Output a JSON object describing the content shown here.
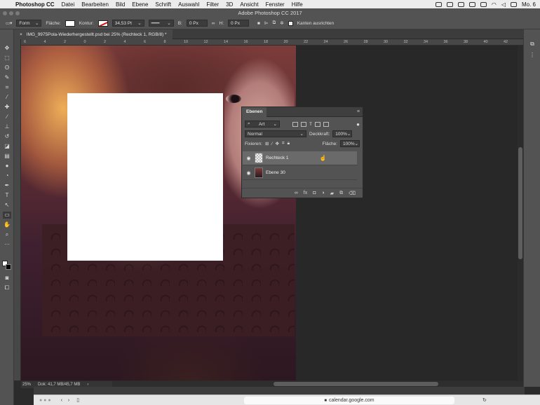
{
  "menubar": {
    "app_name": "Photoshop CC",
    "items": [
      "Datei",
      "Bearbeiten",
      "Bild",
      "Ebene",
      "Schrift",
      "Auswahl",
      "Filter",
      "3D",
      "Ansicht",
      "Fenster",
      "Hilfe"
    ],
    "clock": "Mo. 6"
  },
  "window": {
    "title": "Adobe Photoshop CC 2017"
  },
  "options": {
    "mode": "Form",
    "fill_label": "Fläche:",
    "stroke_label": "Kontur:",
    "stroke_width": "34,53 Pt",
    "w_label": "B:",
    "w_value": "0 Px",
    "h_label": "H:",
    "h_value": "0 Px",
    "align_edges": "Kanten ausrichten"
  },
  "document": {
    "tab_title": "IMG_9975Pola-Wiederhergestellt.psd bei 25% (Rechteck 1, RGB/8) *"
  },
  "ruler": {
    "ticks": [
      "6",
      "4",
      "2",
      "0",
      "2",
      "4",
      "6",
      "8",
      "10",
      "12",
      "14",
      "16",
      "18",
      "20",
      "22",
      "24",
      "26",
      "28",
      "30",
      "32",
      "34",
      "36",
      "38",
      "40",
      "42"
    ]
  },
  "status": {
    "zoom": "25%",
    "doc": "Dok: 41,7 MB/45,7 MB"
  },
  "layers_panel": {
    "title": "Ebenen",
    "filter": "Art",
    "blend_mode": "Normal",
    "opacity_label": "Deckkraft:",
    "opacity_value": "100%",
    "lock_label": "Fixieren:",
    "fill_label": "Fläche:",
    "fill_value": "100%",
    "layers": [
      {
        "name": "Rechteck 1",
        "selected": true
      },
      {
        "name": "Ebene 30",
        "selected": false
      }
    ]
  },
  "browser": {
    "url": "calendar.google.com"
  },
  "colors": {
    "accent_stroke": "#d11111",
    "panel_bg": "#535353",
    "canvas_bg": "#282828"
  }
}
